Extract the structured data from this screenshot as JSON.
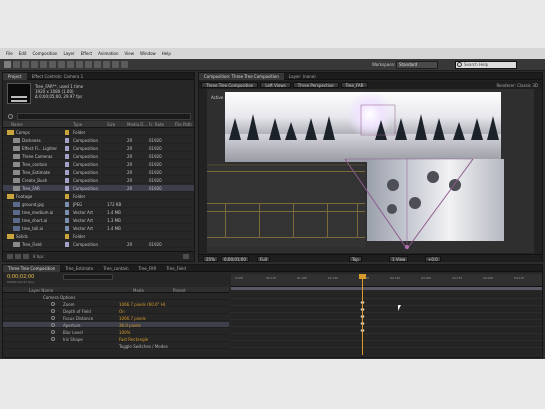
{
  "menu": [
    "File",
    "Edit",
    "Composition",
    "Layer",
    "Effect",
    "Animation",
    "View",
    "Window",
    "Help"
  ],
  "toolbar": {
    "workspace_label": "Workspace:",
    "workspace_value": "Standard",
    "search_placeholder": "Search Help"
  },
  "project": {
    "tabs": [
      "Project",
      "Effect Controls: Camera 1"
    ],
    "item_name": "Tree_FAR**, used 1 time",
    "item_size": "1920 x 1080 (1.00)",
    "item_duration": "Δ 0;00;05;00, 29.97 fps",
    "columns": [
      "Name",
      "Type",
      "Size",
      "Media D...",
      "Fr. Rate",
      "File Path"
    ],
    "rows": [
      {
        "name": "Comps",
        "type": "Folder",
        "size": "",
        "media": "",
        "rate": ""
      },
      {
        "name": "Darkness",
        "type": "Composition",
        "size": "",
        "media": "29",
        "rate": "01920"
      },
      {
        "name": "Effect Fi... Lighter",
        "type": "Composition",
        "size": "",
        "media": "29",
        "rate": "01920"
      },
      {
        "name": "Three Cameras",
        "type": "Composition",
        "size": "",
        "media": "29",
        "rate": "01920"
      },
      {
        "name": "Tree_contain",
        "type": "Composition",
        "size": "",
        "media": "29",
        "rate": "01920"
      },
      {
        "name": "Tree_Estimate",
        "type": "Composition",
        "size": "",
        "media": "29",
        "rate": "01920"
      },
      {
        "name": "Create_Bush",
        "type": "Composition",
        "size": "",
        "media": "29",
        "rate": "01920"
      },
      {
        "name": "Tree_FAR",
        "type": "Composition",
        "size": "",
        "media": "29",
        "rate": "01920"
      },
      {
        "name": "Footage",
        "type": "Folder",
        "size": "",
        "media": "",
        "rate": ""
      },
      {
        "name": "ground.jpg",
        "type": "JPEG",
        "size": "172 KB",
        "media": "",
        "rate": ""
      },
      {
        "name": "tree_medium.ai",
        "type": "Vector Art",
        "size": "1.4 MB",
        "media": "",
        "rate": ""
      },
      {
        "name": "tree_short.ai",
        "type": "Vector Art",
        "size": "1.3 MB",
        "media": "",
        "rate": ""
      },
      {
        "name": "tree_tall.ai",
        "type": "Vector Art",
        "size": "1.4 MB",
        "media": "",
        "rate": ""
      },
      {
        "name": "Solids",
        "type": "Folder",
        "size": "",
        "media": "",
        "rate": ""
      },
      {
        "name": "Tree_Field",
        "type": "Composition",
        "size": "",
        "media": "29",
        "rate": "01920"
      }
    ],
    "footer_bpc": "8 bpc"
  },
  "comp": {
    "tabs": [
      "Composition: Three Tree Composition",
      "Layer: (none)"
    ],
    "viewer_tabs": [
      "Three Tree Composition",
      "Left Views",
      "Three Perspective",
      "Tree_FAR"
    ],
    "renderer_label": "Renderer: Classic 3D",
    "camera_label": "Active Camera",
    "controls": [
      "25%",
      "0;00;01;00",
      "Full",
      "Top",
      "1 View",
      "+0.0"
    ]
  },
  "timeline": {
    "tabs": [
      "Three Tree Composition",
      "Tree_Estimate",
      "Tree_contain",
      "Tree_FAR",
      "Tree_Field"
    ],
    "time": "0;00;02;00",
    "time_sub": "00060 (29.97 fps)",
    "columns": [
      "Layer Name",
      "Mode",
      "Parent"
    ],
    "ruler_ticks": [
      "0;00f",
      "00:15f",
      "01:00f",
      "01:15f",
      "02:00f",
      "02:15f",
      "03:00f",
      "03:15f",
      "04:00f",
      "04:15f"
    ],
    "layers": [
      {
        "name": "Camera Options",
        "value": ""
      },
      {
        "name": "Zoom",
        "value": "1066.7 pixels (60.0° H)"
      },
      {
        "name": "Depth of Field",
        "value": "On"
      },
      {
        "name": "Focus Distance",
        "value": "1066.7 pixels"
      },
      {
        "name": "Aperture",
        "value": "36.0 pixels"
      },
      {
        "name": "Blur Level",
        "value": "100%"
      },
      {
        "name": "Iris Shape",
        "value": "Fast Rectangle"
      },
      {
        "name": "Toggle Switches / Modes",
        "value": ""
      }
    ]
  },
  "colors": {
    "accent": "#d89b2e",
    "chrome": "#2c2c2c",
    "panel": "#262626",
    "selection": "#3c3e4c"
  }
}
